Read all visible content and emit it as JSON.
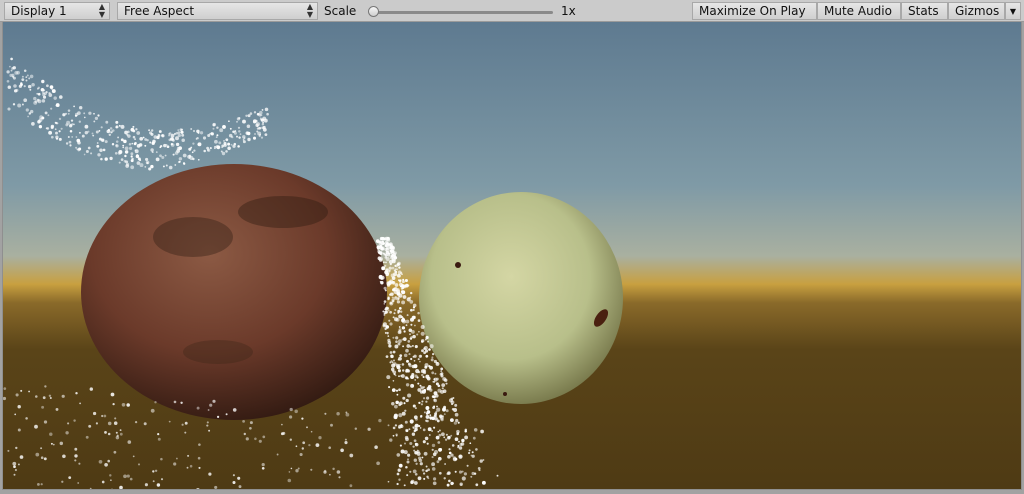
{
  "toolbar": {
    "display": "Display 1",
    "aspect": "Free Aspect",
    "scale_label": "Scale",
    "scale_value": "1x",
    "scale_level": 0,
    "maximize_label": "Maximize On Play",
    "mute_label": "Mute Audio",
    "stats_label": "Stats",
    "gizmos_label": "Gizmos"
  },
  "scene": {
    "sky_top": "#5e7a90",
    "horizon": "#c8a040",
    "ground": "#5a4418",
    "sphere_left_color": "#6b3a2a",
    "sphere_right_color": "#b8bf8a",
    "particle_color": "#ffffff"
  }
}
